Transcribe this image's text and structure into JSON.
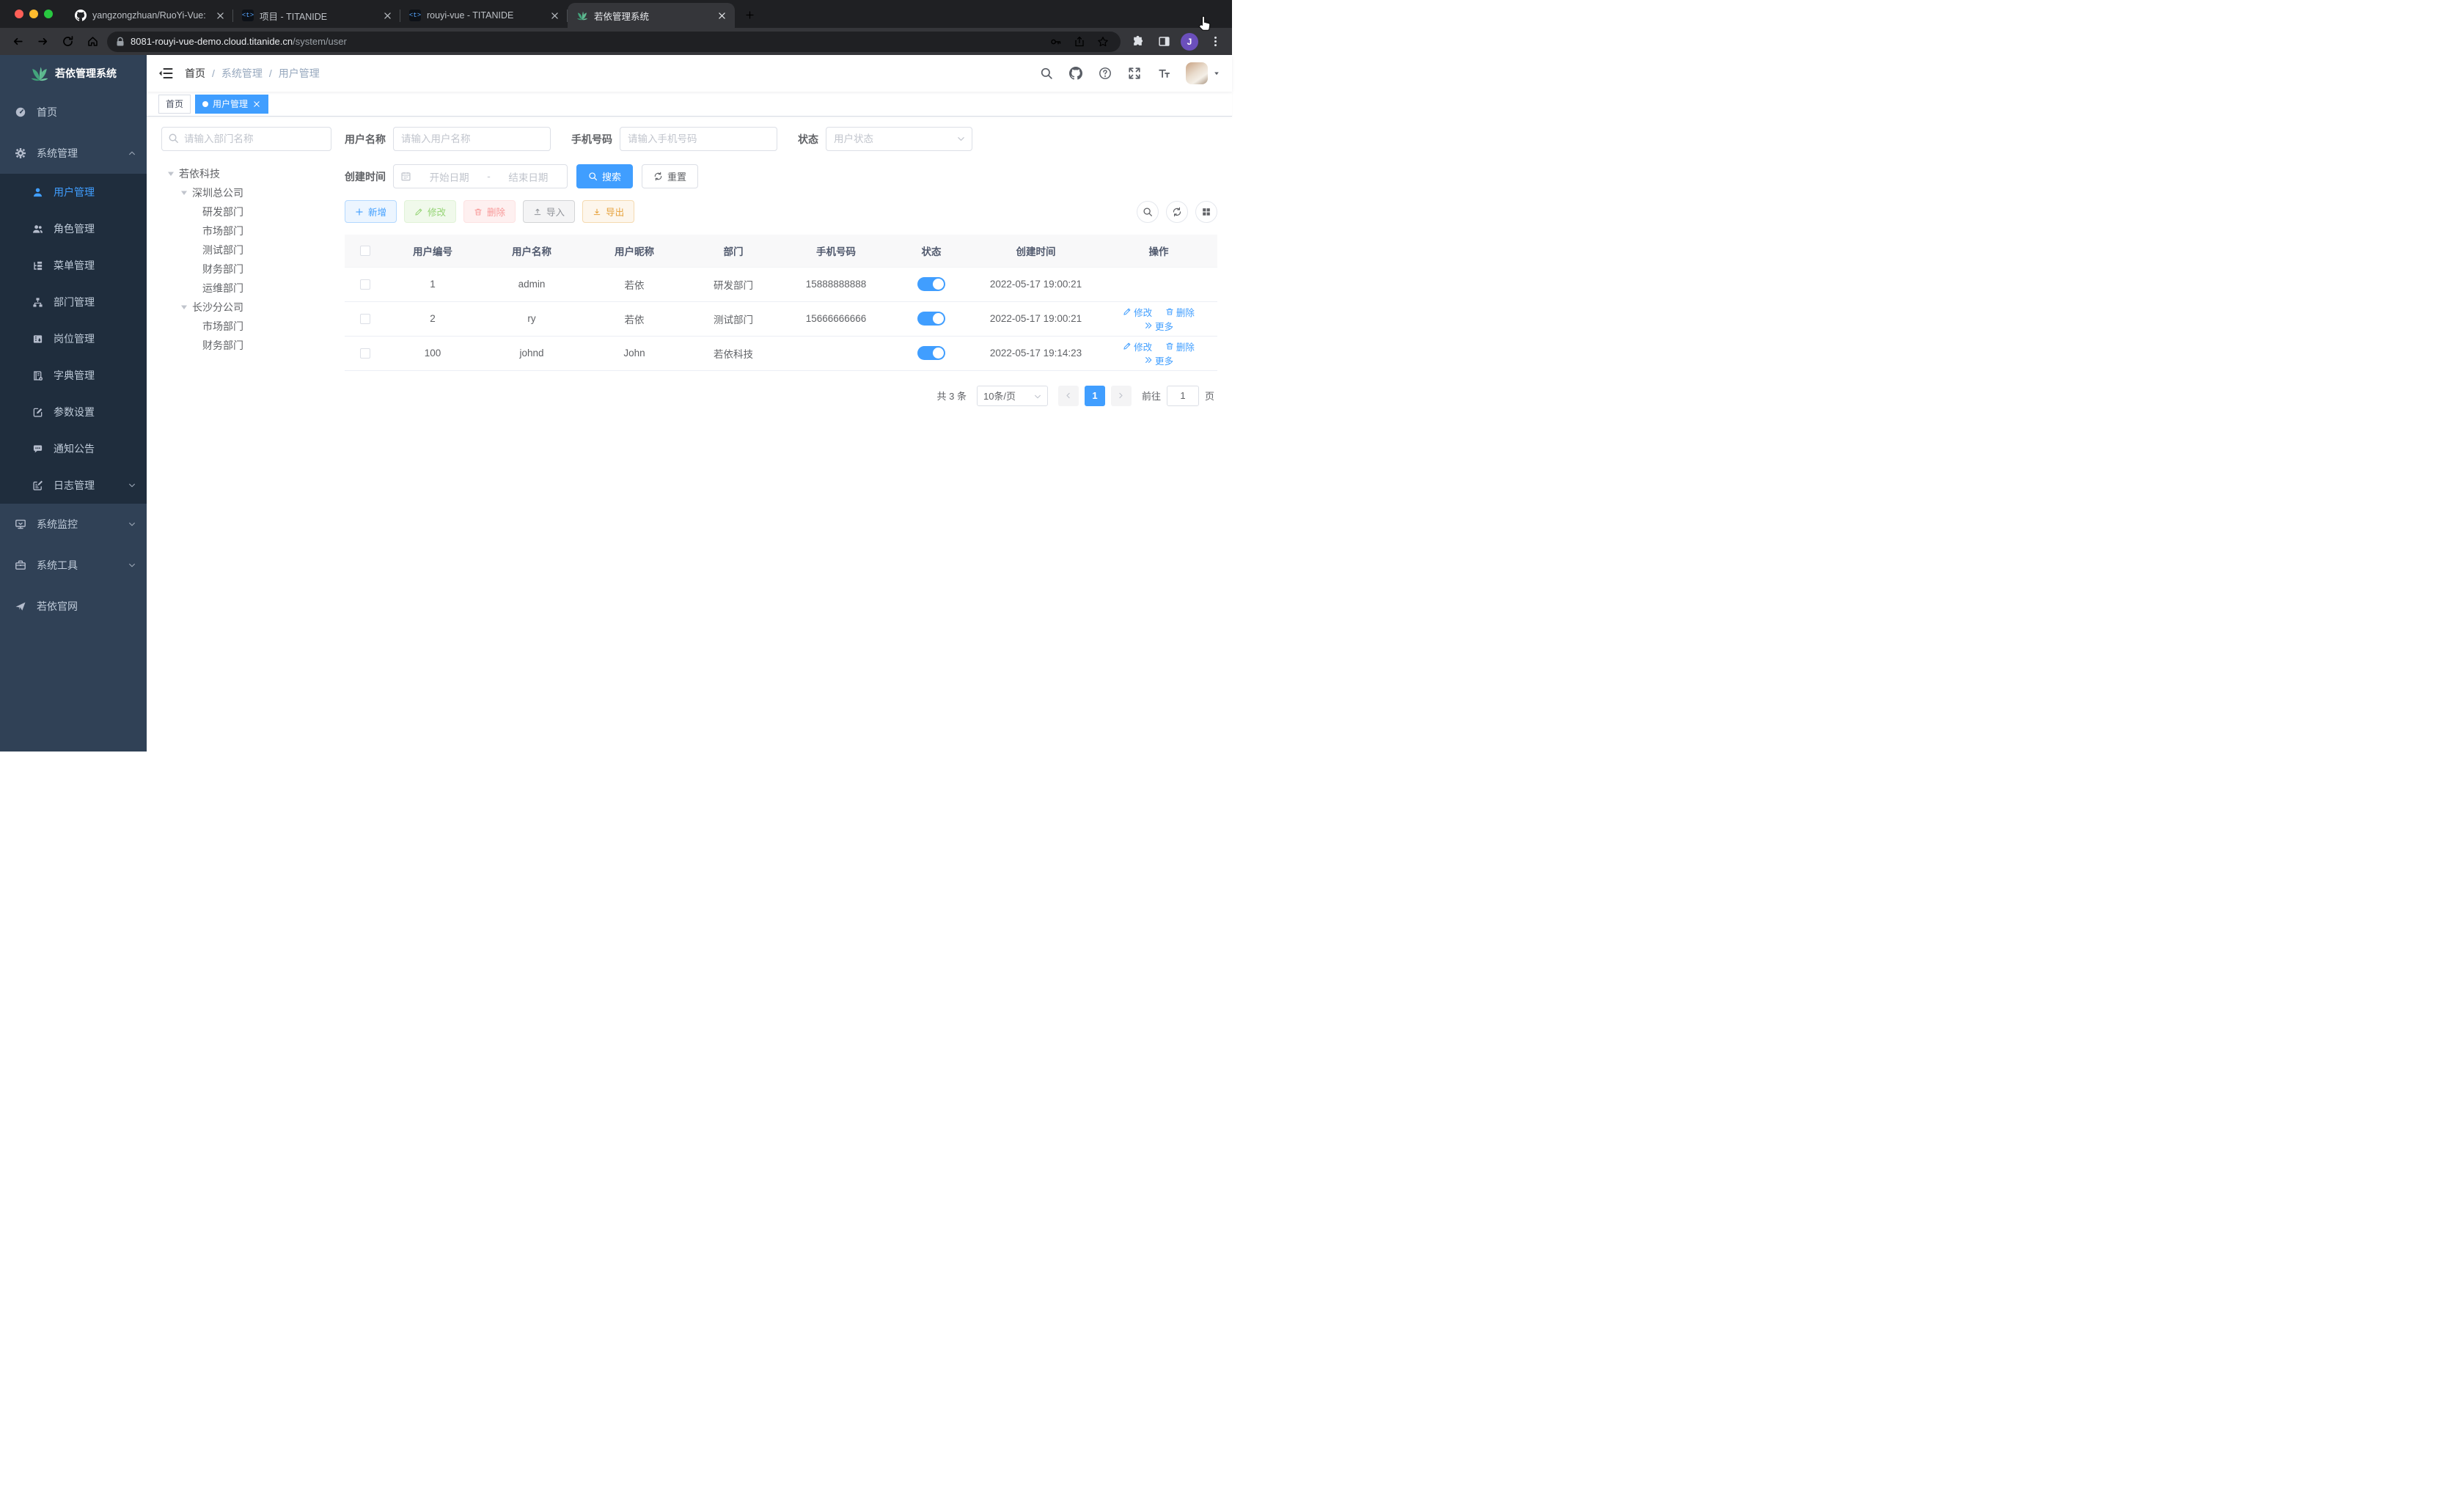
{
  "colors": {
    "accent": "#409EFF",
    "sidebar_bg": "#304156",
    "submenu_bg": "#1f2d3d",
    "success": "#67C23A",
    "danger": "#F56C6C",
    "warning": "#E6A23C",
    "info": "#909399"
  },
  "browser": {
    "tabs": [
      {
        "title": "yangzongzhuan/RuoYi-Vue: (Ru",
        "icon": "github"
      },
      {
        "title": "项目 - TITANIDE",
        "icon": "titanide"
      },
      {
        "title": "rouyi-vue - TITANIDE",
        "icon": "titanide"
      },
      {
        "title": "若依管理系统",
        "icon": "ruoyi-leaf"
      }
    ],
    "titanide_glyph": "<t>",
    "url_host": "8081-rouyi-vue-demo.cloud.titanide.cn",
    "url_path": "/system/user",
    "avatar_letter": "J"
  },
  "app": {
    "logo_title": "若依管理系统",
    "sidebar": {
      "home": "首页",
      "system": "系统管理",
      "system_children": [
        "用户管理",
        "角色管理",
        "菜单管理",
        "部门管理",
        "岗位管理",
        "字典管理",
        "参数设置",
        "通知公告",
        "日志管理"
      ],
      "monitor": "系统监控",
      "tools": "系统工具",
      "site": "若依官网"
    },
    "breadcrumb": [
      "首页",
      "系统管理",
      "用户管理"
    ],
    "tags": [
      {
        "label": "首页"
      },
      {
        "label": "用户管理"
      }
    ],
    "tree": {
      "search_placeholder": "请输入部门名称",
      "nodes": [
        {
          "label": "若依科技"
        },
        {
          "label": "深圳总公司"
        },
        {
          "label": "研发部门"
        },
        {
          "label": "市场部门"
        },
        {
          "label": "测试部门"
        },
        {
          "label": "财务部门"
        },
        {
          "label": "运维部门"
        },
        {
          "label": "长沙分公司"
        },
        {
          "label": "市场部门"
        },
        {
          "label": "财务部门"
        }
      ]
    },
    "filters": {
      "username_label": "用户名称",
      "username_placeholder": "请输入用户名称",
      "phone_label": "手机号码",
      "phone_placeholder": "请输入手机号码",
      "status_label": "状态",
      "status_placeholder": "用户状态",
      "created_label": "创建时间",
      "date_start": "开始日期",
      "date_sep": "-",
      "date_end": "结束日期",
      "search_label": "搜索",
      "reset_label": "重置"
    },
    "toolbar": {
      "add": "新增",
      "edit": "修改",
      "delete": "删除",
      "import": "导入",
      "export": "导出"
    },
    "table": {
      "columns": [
        "用户编号",
        "用户名称",
        "用户昵称",
        "部门",
        "手机号码",
        "状态",
        "创建时间",
        "操作"
      ],
      "rows": [
        {
          "id": "1",
          "username": "admin",
          "nickname": "若依",
          "dept": "研发部门",
          "phone": "15888888888",
          "created": "2022-05-17 19:00:21"
        },
        {
          "id": "2",
          "username": "ry",
          "nickname": "若依",
          "dept": "测试部门",
          "phone": "15666666666",
          "created": "2022-05-17 19:00:21"
        },
        {
          "id": "100",
          "username": "johnd",
          "nickname": "John",
          "dept": "若依科技",
          "phone": "",
          "created": "2022-05-17 19:14:23"
        }
      ]
    },
    "row_actions": {
      "edit": "修改",
      "delete": "删除",
      "more": "更多"
    },
    "pagination": {
      "total_text": "共 3 条",
      "page_size": "10条/页",
      "current_page": "1",
      "goto_label": "前往",
      "goto_value": "1",
      "page_suffix": "页"
    }
  }
}
